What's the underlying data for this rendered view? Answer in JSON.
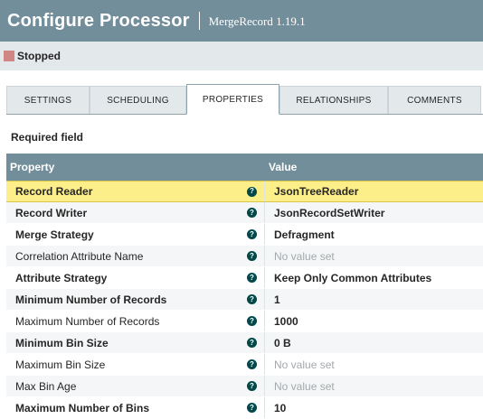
{
  "header": {
    "title": "Configure Processor",
    "subtitle": "MergeRecord 1.19.1"
  },
  "status": {
    "text": "Stopped",
    "color": "#d18686"
  },
  "tabs": [
    {
      "label": "SETTINGS",
      "active": false
    },
    {
      "label": "SCHEDULING",
      "active": false
    },
    {
      "label": "PROPERTIES",
      "active": true
    },
    {
      "label": "RELATIONSHIPS",
      "active": false
    },
    {
      "label": "COMMENTS",
      "active": false
    }
  ],
  "required_label": "Required field",
  "grid": {
    "columns": {
      "property": "Property",
      "value": "Value"
    },
    "help_glyph": "?",
    "rows": [
      {
        "property": "Record Reader",
        "value": "JsonTreeReader",
        "required": true,
        "unset": false,
        "selected": true
      },
      {
        "property": "Record Writer",
        "value": "JsonRecordSetWriter",
        "required": true,
        "unset": false,
        "selected": false
      },
      {
        "property": "Merge Strategy",
        "value": "Defragment",
        "required": true,
        "unset": false,
        "selected": false
      },
      {
        "property": "Correlation Attribute Name",
        "value": "No value set",
        "required": false,
        "unset": true,
        "selected": false
      },
      {
        "property": "Attribute Strategy",
        "value": "Keep Only Common Attributes",
        "required": true,
        "unset": false,
        "selected": false
      },
      {
        "property": "Minimum Number of Records",
        "value": "1",
        "required": true,
        "unset": false,
        "selected": false
      },
      {
        "property": "Maximum Number of Records",
        "value": "1000",
        "required": false,
        "unset": false,
        "selected": false
      },
      {
        "property": "Minimum Bin Size",
        "value": "0 B",
        "required": true,
        "unset": false,
        "selected": false
      },
      {
        "property": "Maximum Bin Size",
        "value": "No value set",
        "required": false,
        "unset": true,
        "selected": false
      },
      {
        "property": "Max Bin Age",
        "value": "No value set",
        "required": false,
        "unset": true,
        "selected": false
      },
      {
        "property": "Maximum Number of Bins",
        "value": "10",
        "required": true,
        "unset": false,
        "selected": false
      }
    ]
  },
  "colors": {
    "header_bg": "#728e9b",
    "status_bar_bg": "#e3e8eb",
    "selected_row": "#fcee88",
    "help_icon": "#004849"
  }
}
